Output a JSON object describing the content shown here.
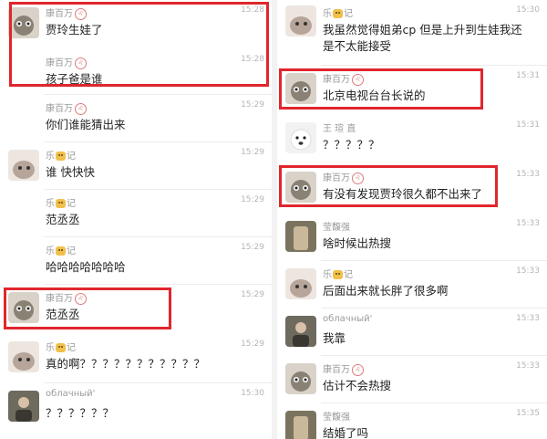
{
  "left": {
    "messages": [
      {
        "sender": "康百万",
        "badge": "♌",
        "time": "15:28",
        "text": "贾玲生娃了"
      },
      {
        "sender": "康百万",
        "badge": "♌",
        "time": "15:28",
        "text": "孩子爸是谁"
      },
      {
        "sender": "康百万",
        "badge": "♌",
        "time": "15:29",
        "text": "你们谁能猜出来"
      },
      {
        "sender": "乐记",
        "time": "15:29",
        "text": "谁 快快快"
      },
      {
        "sender": "乐记",
        "time": "15:29",
        "text": "范丞丞"
      },
      {
        "sender": "乐记",
        "time": "15:29",
        "text": "哈哈哈哈哈哈哈"
      },
      {
        "sender": "康百万",
        "badge": "♌",
        "time": "15:29",
        "text": "范丞丞"
      },
      {
        "sender": "乐记",
        "time": "15:29",
        "text": "真的啊？？？？？？？？？？？"
      },
      {
        "sender": "облачный'",
        "time": "15:30",
        "text": "？？？？？？"
      }
    ]
  },
  "right": {
    "messages": [
      {
        "sender": "乐记",
        "time": "15:30",
        "text": "我虽然觉得姐弟cp 但是上升到生娃我还是不太能接受"
      },
      {
        "sender": "康百万",
        "badge": "♌",
        "time": "15:31",
        "text": "北京电视台台长说的"
      },
      {
        "sender": "王 瑄 直",
        "time": "15:31",
        "text": "？？？？？"
      },
      {
        "sender": "康百万",
        "badge": "♌",
        "time": "15:33",
        "text": "有没有发现贾玲很久都不出来了"
      },
      {
        "sender": "莹馥强",
        "time": "15:33",
        "text": "啥时候出热搜"
      },
      {
        "sender": "乐记",
        "time": "15:33",
        "text": "后面出来就长胖了很多啊"
      },
      {
        "sender": "облачный'",
        "time": "15:33",
        "text": "我靠"
      },
      {
        "sender": "康百万",
        "badge": "♌",
        "time": "15:33",
        "text": "估计不会热搜"
      },
      {
        "sender": "莹馥强",
        "time": "15:35",
        "text": "结婚了吗"
      }
    ]
  },
  "colors": {
    "highlight": "#e0262d",
    "time": "#b5b5b5",
    "nick": "#9a9a9a",
    "text": "#222222"
  },
  "icons": {
    "badge": "zodiac-badge-icon",
    "emoji": "cat-emoji-icon"
  }
}
